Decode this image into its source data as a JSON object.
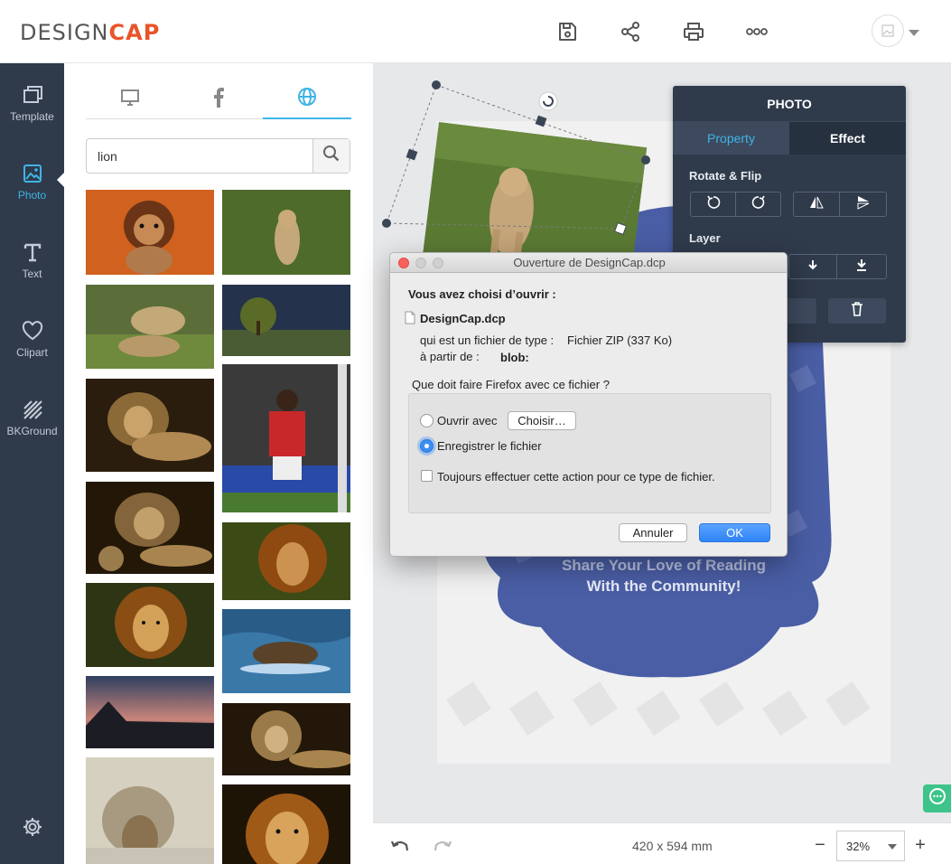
{
  "header": {
    "logo_main": "DESIGN",
    "logo_accent": "CAP",
    "actions": [
      "save-icon",
      "share-icon",
      "print-icon",
      "more-icon"
    ],
    "colors": {
      "brand": "#e8542a",
      "accent": "#3fb4e6",
      "rail": "#2f3a4b"
    }
  },
  "rail": {
    "items": [
      {
        "label": "Template",
        "icon": "template-icon"
      },
      {
        "label": "Photo",
        "icon": "photo-icon"
      },
      {
        "label": "Text",
        "icon": "text-icon"
      },
      {
        "label": "Clipart",
        "icon": "heart-icon"
      },
      {
        "label": "BKGround",
        "icon": "background-icon"
      }
    ],
    "active": "Photo"
  },
  "photo_panel": {
    "tabs": [
      "desktop-icon",
      "facebook-icon",
      "globe-icon"
    ],
    "active_tab": "globe-icon",
    "search": {
      "value": "lion",
      "placeholder": ""
    }
  },
  "canvas": {
    "text_line1": "Share Your Love of Reading",
    "text_line2": "With the Community!",
    "size": "420 x 594 mm",
    "zoom": "32%"
  },
  "floating_panel": {
    "title": "PHOTO",
    "tab_property": "Property",
    "tab_effect": "Effect",
    "rotate_flip": "Rotate & Flip",
    "layer": "Layer"
  },
  "dialog": {
    "title": "Ouverture de DesignCap.dcp",
    "intro": "Vous avez choisi d’ouvrir :",
    "filename": "DesignCap.dcp",
    "type_label": "qui est un fichier de type :",
    "type_value": "Fichier ZIP (337 Ko)",
    "from_label": "à partir de :",
    "from_value": "blob:",
    "question": "Que doit faire Firefox avec ce fichier ?",
    "open_with": "Ouvrir avec",
    "choose": "Choisir…",
    "save_file": "Enregistrer le fichier",
    "always": "Toujours effectuer cette action pour ce type de fichier.",
    "cancel": "Annuler",
    "ok": "OK",
    "selected_option": "save_file",
    "always_checked": false
  }
}
